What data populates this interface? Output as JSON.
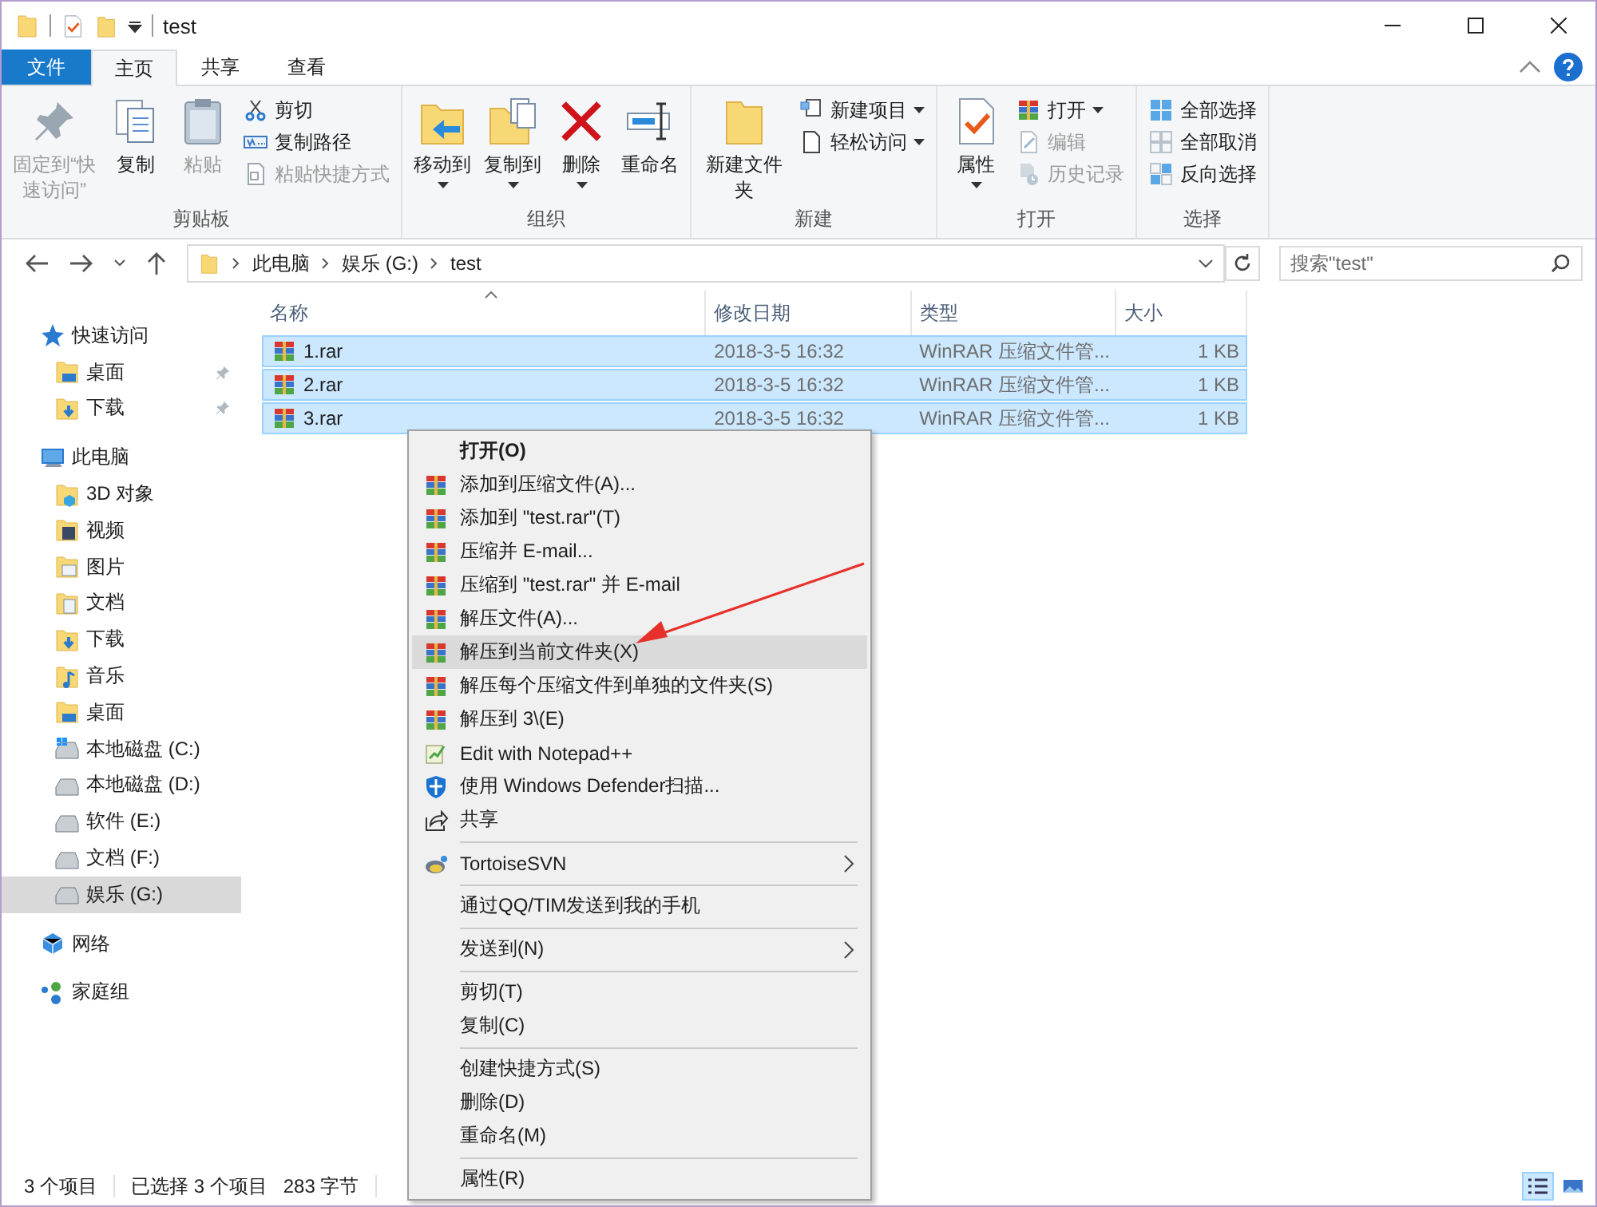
{
  "window": {
    "title": "test"
  },
  "ribbon_tabs": [
    {
      "label": "文件",
      "kind": "file",
      "selected": false
    },
    {
      "label": "主页",
      "kind": "tab",
      "selected": true
    },
    {
      "label": "共享",
      "kind": "tab",
      "selected": false
    },
    {
      "label": "查看",
      "kind": "tab",
      "selected": false
    }
  ],
  "ribbon_groups": [
    {
      "label": "剪贴板",
      "large": [
        {
          "label": "固定到“快速访问”",
          "disabled": true,
          "dropdown": false
        },
        {
          "label": "复制",
          "disabled": false,
          "dropdown": false
        },
        {
          "label": "粘贴",
          "disabled": true,
          "dropdown": false
        }
      ],
      "small": [
        {
          "label": "剪切",
          "disabled": false,
          "dropdown": false
        },
        {
          "label": "复制路径",
          "disabled": false,
          "dropdown": false
        },
        {
          "label": "粘贴快捷方式",
          "disabled": true,
          "dropdown": false
        }
      ]
    },
    {
      "label": "组织",
      "large": [
        {
          "label": "移动到",
          "disabled": false,
          "dropdown": true
        },
        {
          "label": "复制到",
          "disabled": false,
          "dropdown": true
        },
        {
          "label": "删除",
          "disabled": false,
          "dropdown": true
        },
        {
          "label": "重命名",
          "disabled": false,
          "dropdown": false
        }
      ]
    },
    {
      "label": "新建",
      "large": [
        {
          "label": "新建文件夹",
          "disabled": false,
          "dropdown": false
        }
      ],
      "small": [
        {
          "label": "新建项目",
          "disabled": false,
          "dropdown": true
        },
        {
          "label": "轻松访问",
          "disabled": false,
          "dropdown": true
        }
      ]
    },
    {
      "label": "打开",
      "large": [
        {
          "label": "属性",
          "disabled": false,
          "dropdown": true
        }
      ],
      "small": [
        {
          "label": "打开",
          "disabled": false,
          "dropdown": true
        },
        {
          "label": "编辑",
          "disabled": true,
          "dropdown": false
        },
        {
          "label": "历史记录",
          "disabled": true,
          "dropdown": false
        }
      ]
    },
    {
      "label": "选择",
      "small": [
        {
          "label": "全部选择",
          "disabled": false,
          "dropdown": false
        },
        {
          "label": "全部取消",
          "disabled": false,
          "dropdown": false
        },
        {
          "label": "反向选择",
          "disabled": false,
          "dropdown": false
        }
      ]
    }
  ],
  "address": {
    "segments": [
      "此电脑",
      "娱乐 (G:)",
      "test"
    ],
    "search_placeholder": "搜索\"test\""
  },
  "sidebar": [
    {
      "label": "快速访问",
      "kind": "star",
      "selected": false,
      "children": [
        {
          "label": "桌面",
          "kind": "desktop",
          "selected": false,
          "pinned": true
        },
        {
          "label": "下载",
          "kind": "download",
          "selected": false,
          "pinned": true
        }
      ]
    },
    {
      "label": "此电脑",
      "kind": "pc",
      "selected": false,
      "children": [
        {
          "label": "3D 对象",
          "kind": "objects",
          "selected": false
        },
        {
          "label": "视频",
          "kind": "video",
          "selected": false
        },
        {
          "label": "图片",
          "kind": "pictures",
          "selected": false
        },
        {
          "label": "文档",
          "kind": "documents",
          "selected": false
        },
        {
          "label": "下载",
          "kind": "download",
          "selected": false
        },
        {
          "label": "音乐",
          "kind": "music",
          "selected": false
        },
        {
          "label": "桌面",
          "kind": "desktop",
          "selected": false
        },
        {
          "label": "本地磁盘 (C:)",
          "kind": "system-drive",
          "selected": false
        },
        {
          "label": "本地磁盘 (D:)",
          "kind": "drive",
          "selected": false
        },
        {
          "label": "软件 (E:)",
          "kind": "drive",
          "selected": false
        },
        {
          "label": "文档 (F:)",
          "kind": "drive",
          "selected": false
        },
        {
          "label": "娱乐 (G:)",
          "kind": "drive",
          "selected": true
        }
      ]
    },
    {
      "label": "网络",
      "kind": "network",
      "selected": false
    },
    {
      "label": "家庭组",
      "kind": "homegroup",
      "selected": false
    }
  ],
  "columns": [
    {
      "label": "名称",
      "sorted": true
    },
    {
      "label": "修改日期",
      "sorted": false
    },
    {
      "label": "类型",
      "sorted": false
    },
    {
      "label": "大小",
      "sorted": false
    }
  ],
  "files": [
    {
      "name": "1.rar",
      "modified": "2018-3-5 16:32",
      "type": "WinRAR 压缩文件管...",
      "size": "1 KB",
      "selected": true
    },
    {
      "name": "2.rar",
      "modified": "2018-3-5 16:32",
      "type": "WinRAR 压缩文件管...",
      "size": "1 KB",
      "selected": true
    },
    {
      "name": "3.rar",
      "modified": "2018-3-5 16:32",
      "type": "WinRAR 压缩文件管...",
      "size": "1 KB",
      "selected": true
    }
  ],
  "context_menu": [
    {
      "label": "打开(O)",
      "kind": "default",
      "highlighted": false,
      "submenu": false
    },
    {
      "label": "添加到压缩文件(A)...",
      "kind": "rar",
      "highlighted": false,
      "submenu": false
    },
    {
      "label": "添加到 \"test.rar\"(T)",
      "kind": "rar",
      "highlighted": false,
      "submenu": false
    },
    {
      "label": "压缩并 E-mail...",
      "kind": "rar",
      "highlighted": false,
      "submenu": false
    },
    {
      "label": "压缩到 \"test.rar\" 并 E-mail",
      "kind": "rar",
      "highlighted": false,
      "submenu": false
    },
    {
      "label": "解压文件(A)...",
      "kind": "rar",
      "highlighted": false,
      "submenu": false
    },
    {
      "label": "解压到当前文件夹(X)",
      "kind": "rar",
      "highlighted": true,
      "submenu": false
    },
    {
      "label": "解压每个压缩文件到单独的文件夹(S)",
      "kind": "rar",
      "highlighted": false,
      "submenu": false
    },
    {
      "label": "解压到 3\\(E)",
      "kind": "rar",
      "highlighted": false,
      "submenu": false
    },
    {
      "label": "Edit with Notepad++",
      "kind": "notepad",
      "highlighted": false,
      "submenu": false
    },
    {
      "label": "使用 Windows Defender扫描...",
      "kind": "shield",
      "highlighted": false,
      "submenu": false
    },
    {
      "label": "共享",
      "kind": "share",
      "highlighted": false,
      "submenu": false
    },
    {
      "kind": "separator"
    },
    {
      "label": "TortoiseSVN",
      "kind": "svn",
      "highlighted": false,
      "submenu": true
    },
    {
      "kind": "separator"
    },
    {
      "label": "通过QQ/TIM发送到我的手机",
      "kind": "text",
      "highlighted": false,
      "submenu": false
    },
    {
      "kind": "separator"
    },
    {
      "label": "发送到(N)",
      "kind": "text",
      "highlighted": false,
      "submenu": true
    },
    {
      "kind": "separator"
    },
    {
      "label": "剪切(T)",
      "kind": "text",
      "highlighted": false,
      "submenu": false
    },
    {
      "label": "复制(C)",
      "kind": "text",
      "highlighted": false,
      "submenu": false
    },
    {
      "kind": "separator"
    },
    {
      "label": "创建快捷方式(S)",
      "kind": "text",
      "highlighted": false,
      "submenu": false
    },
    {
      "label": "删除(D)",
      "kind": "text",
      "highlighted": false,
      "submenu": false
    },
    {
      "label": "重命名(M)",
      "kind": "text",
      "highlighted": false,
      "submenu": false
    },
    {
      "kind": "separator"
    },
    {
      "label": "属性(R)",
      "kind": "text",
      "highlighted": false,
      "submenu": false
    }
  ],
  "status_bar": {
    "item_count": "3 个项目",
    "selection": "已选择 3 个项目",
    "selection_size": "283 字节",
    "views": [
      {
        "kind": "details",
        "selected": true
      },
      {
        "kind": "large-icons",
        "selected": false
      }
    ]
  }
}
